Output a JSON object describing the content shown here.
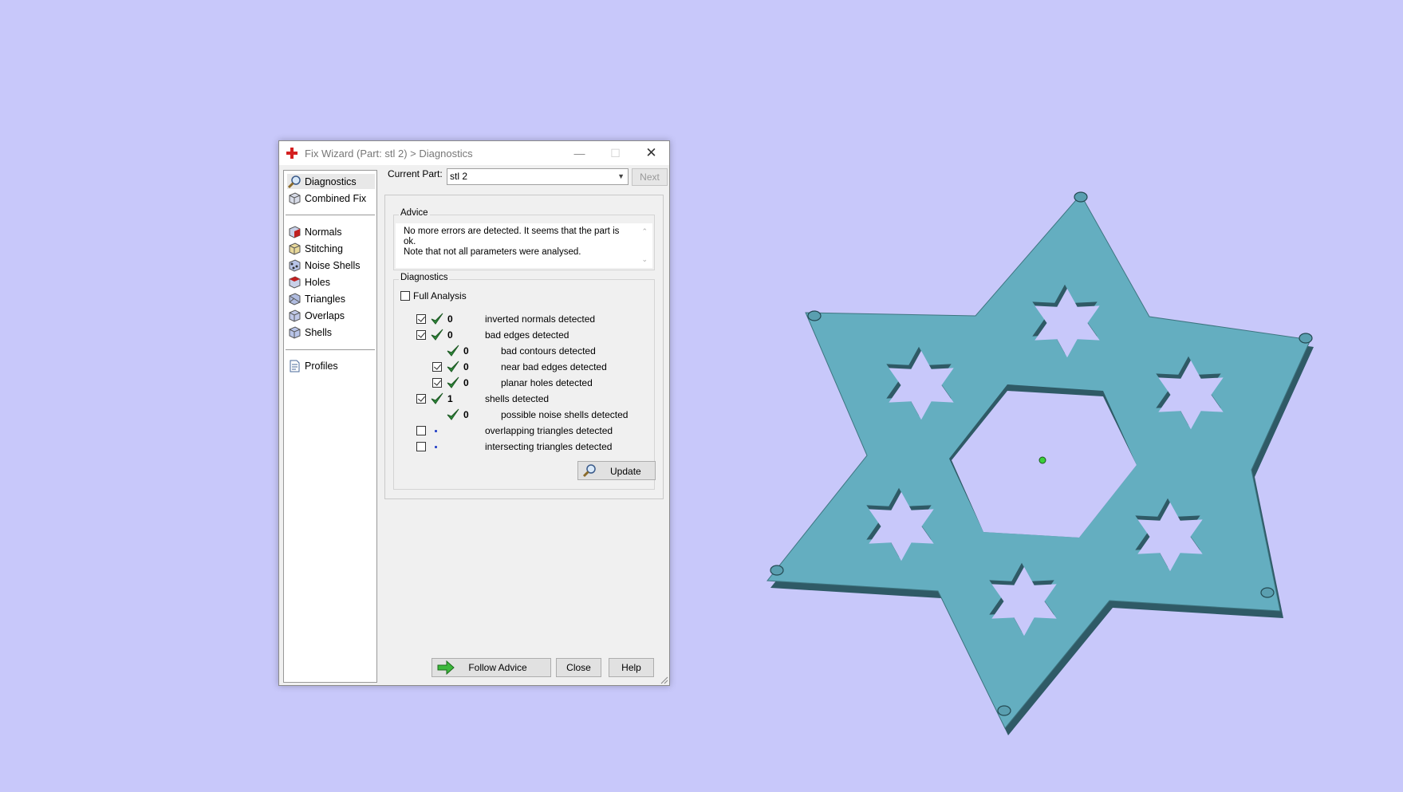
{
  "dialog": {
    "title": "Fix Wizard (Part: stl 2) > Diagnostics",
    "window_buttons": {
      "minimize": "—",
      "maximize": "☐",
      "close": "✕"
    }
  },
  "nav": {
    "items": [
      {
        "label": "Diagnostics",
        "icon": "magnifier-icon",
        "selected": true
      },
      {
        "label": "Combined Fix",
        "icon": "cube-icon"
      },
      {
        "label": "Normals",
        "icon": "normals-cube-icon"
      },
      {
        "label": "Stitching",
        "icon": "stitching-cube-icon"
      },
      {
        "label": "Noise Shells",
        "icon": "noise-shells-icon"
      },
      {
        "label": "Holes",
        "icon": "holes-cube-icon"
      },
      {
        "label": "Triangles",
        "icon": "triangles-cube-icon"
      },
      {
        "label": "Overlaps",
        "icon": "overlaps-cube-icon"
      },
      {
        "label": "Shells",
        "icon": "shells-cube-icon"
      },
      {
        "label": "Profiles",
        "icon": "profile-document-icon"
      }
    ]
  },
  "current_part": {
    "label": "Current Part:",
    "value": "stl 2",
    "next_label": "Next"
  },
  "advice": {
    "title": "Advice",
    "line1": "No more errors are detected. It seems that the part is ok.",
    "line2": "Note that not all parameters were analysed."
  },
  "diagnostics": {
    "title": "Diagnostics",
    "full_analysis_label": "Full Analysis",
    "full_analysis_checked": false,
    "rows": [
      {
        "label": "inverted normals detected",
        "count": "0",
        "checked": true,
        "status": "ok",
        "indent": 0,
        "has_checkbox": true
      },
      {
        "label": "bad edges detected",
        "count": "0",
        "checked": true,
        "status": "ok",
        "indent": 0,
        "has_checkbox": true
      },
      {
        "label": "bad contours detected",
        "count": "0",
        "checked": false,
        "status": "ok",
        "indent": 1,
        "has_checkbox": false
      },
      {
        "label": "near bad edges detected",
        "count": "0",
        "checked": true,
        "status": "ok",
        "indent": 1,
        "has_checkbox": true
      },
      {
        "label": "planar holes detected",
        "count": "0",
        "checked": true,
        "status": "ok",
        "indent": 1,
        "has_checkbox": true
      },
      {
        "label": "shells detected",
        "count": "1",
        "checked": true,
        "status": "ok",
        "indent": 0,
        "has_checkbox": true
      },
      {
        "label": "possible noise shells detected",
        "count": "0",
        "checked": false,
        "status": "ok",
        "indent": 1,
        "has_checkbox": false
      },
      {
        "label": "overlapping triangles detected",
        "count": "",
        "checked": false,
        "status": "not-run",
        "indent": 0,
        "has_checkbox": true
      },
      {
        "label": "intersecting triangles detected",
        "count": "",
        "checked": false,
        "status": "not-run",
        "indent": 0,
        "has_checkbox": true
      }
    ],
    "update_label": "Update"
  },
  "footer": {
    "follow_advice_label": "Follow Advice",
    "close_label": "Close",
    "help_label": "Help"
  },
  "colors": {
    "background": "#c8c8fa",
    "part_top": "#64aec0",
    "part_side": "#2f5a66",
    "check_green": "#2e8b3a"
  }
}
